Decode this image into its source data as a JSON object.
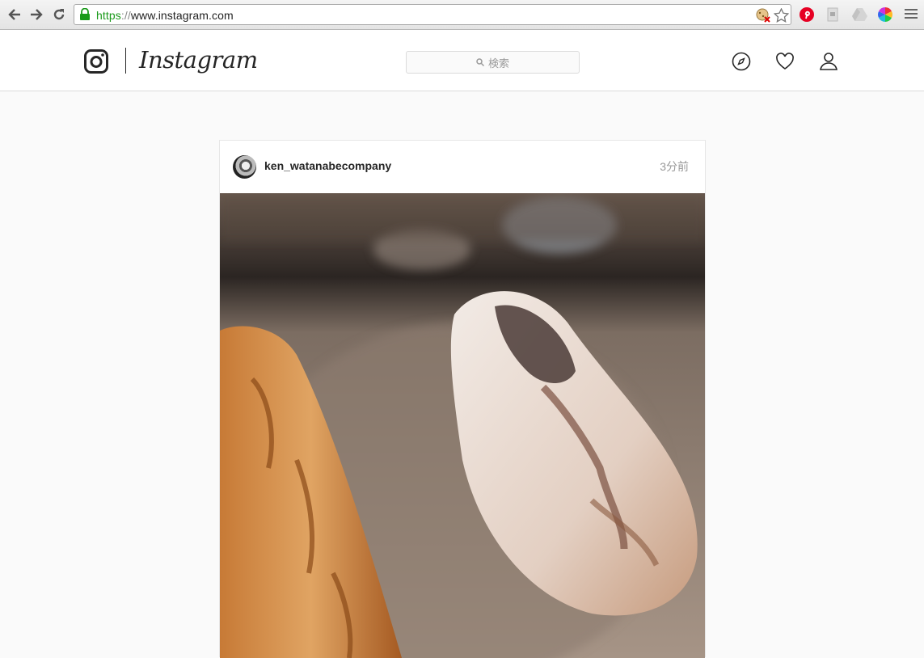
{
  "browser": {
    "url_scheme": "https",
    "url_sep": "://",
    "url_host": "www.instagram.com"
  },
  "header": {
    "wordmark": "Instagram",
    "search_placeholder": "検索"
  },
  "post": {
    "username": "ken_watanabecompany",
    "timestamp": "3分前"
  },
  "icons": {
    "back": "back-arrow-icon",
    "forward": "forward-arrow-icon",
    "reload": "reload-icon",
    "lock": "lock-icon",
    "star": "star-icon",
    "explore": "compass-icon",
    "activity": "heart-icon",
    "profile": "person-icon"
  },
  "colors": {
    "secure_green": "#1a9a1a",
    "pinterest_red": "#e60023",
    "text_dark": "#262626",
    "text_muted": "#999999"
  }
}
